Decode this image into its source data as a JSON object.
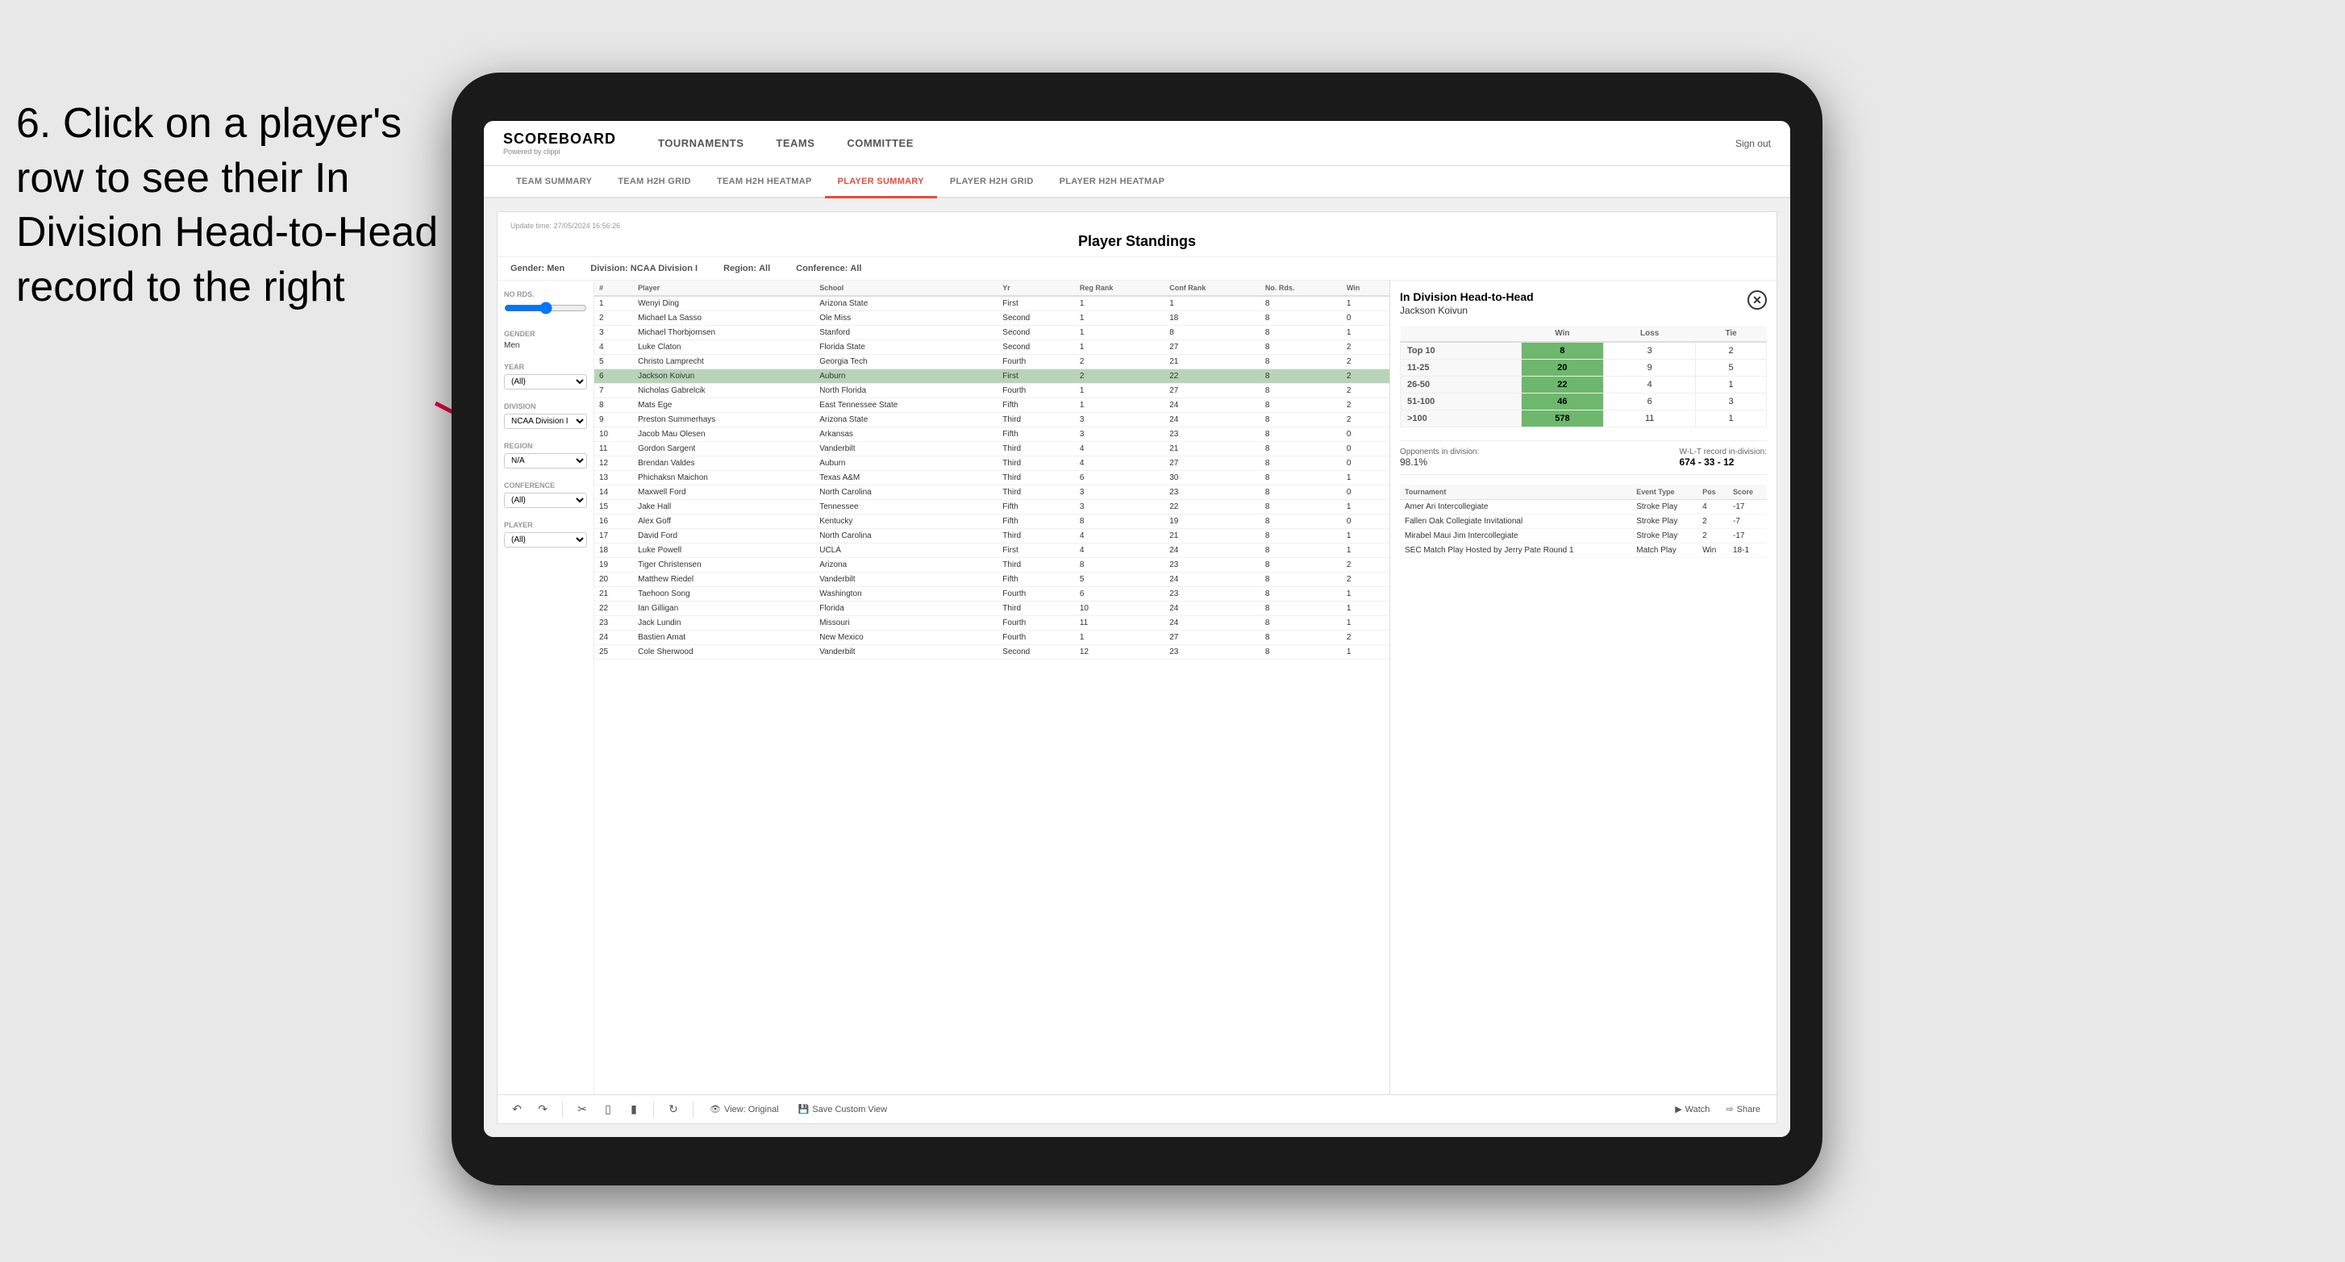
{
  "instruction": {
    "text": "6. Click on a player's row to see their In Division Head-to-Head record to the right"
  },
  "nav": {
    "logo": "SCOREBOARD",
    "logo_sub": "Powered by clippi",
    "items": [
      "TOURNAMENTS",
      "TEAMS",
      "COMMITTEE"
    ],
    "sign_out": "Sign out"
  },
  "sub_nav": {
    "items": [
      "TEAM SUMMARY",
      "TEAM H2H GRID",
      "TEAM H2H HEATMAP",
      "PLAYER SUMMARY",
      "PLAYER H2H GRID",
      "PLAYER H2H HEATMAP"
    ],
    "active": "PLAYER SUMMARY"
  },
  "panel": {
    "update_label": "Update time:",
    "update_time": "27/05/2024 16:56:26",
    "title": "Player Standings",
    "filters": {
      "gender_label": "Gender:",
      "gender_value": "Men",
      "division_label": "Division:",
      "division_value": "NCAA Division I",
      "region_label": "Region:",
      "region_value": "All",
      "conference_label": "Conference:",
      "conference_value": "All"
    }
  },
  "sidebar": {
    "no_rds_label": "No Rds.",
    "gender_label": "Gender",
    "gender_value": "Men",
    "year_label": "Year",
    "year_value": "(All)",
    "division_label": "Division",
    "division_value": "NCAA Division I",
    "region_label": "Region",
    "region_value": "N/A",
    "conference_label": "Conference",
    "conference_value": "(All)",
    "player_label": "Player",
    "player_value": "(All)"
  },
  "table": {
    "headers": [
      "#",
      "Player",
      "School",
      "Yr",
      "Reg Rank",
      "Conf Rank",
      "No. Rds.",
      "Win"
    ],
    "rows": [
      {
        "num": 1,
        "player": "Wenyi Ding",
        "school": "Arizona State",
        "yr": "First",
        "reg_rank": 1,
        "conf_rank": 1,
        "no_rds": 8,
        "win": 1,
        "selected": false
      },
      {
        "num": 2,
        "player": "Michael La Sasso",
        "school": "Ole Miss",
        "yr": "Second",
        "reg_rank": 1,
        "conf_rank": 18,
        "no_rds": 8,
        "win": 0,
        "selected": false
      },
      {
        "num": 3,
        "player": "Michael Thorbjornsen",
        "school": "Stanford",
        "yr": "Second",
        "reg_rank": 1,
        "conf_rank": 8,
        "no_rds": 8,
        "win": 1,
        "selected": false
      },
      {
        "num": 4,
        "player": "Luke Claton",
        "school": "Florida State",
        "yr": "Second",
        "reg_rank": 1,
        "conf_rank": 27,
        "no_rds": 8,
        "win": 2,
        "selected": false
      },
      {
        "num": 5,
        "player": "Christo Lamprecht",
        "school": "Georgia Tech",
        "yr": "Fourth",
        "reg_rank": 2,
        "conf_rank": 21,
        "no_rds": 8,
        "win": 2,
        "selected": false
      },
      {
        "num": 6,
        "player": "Jackson Koivun",
        "school": "Auburn",
        "yr": "First",
        "reg_rank": 2,
        "conf_rank": 22,
        "no_rds": 8,
        "win": 2,
        "selected": true
      },
      {
        "num": 7,
        "player": "Nicholas Gabrelcik",
        "school": "North Florida",
        "yr": "Fourth",
        "reg_rank": 1,
        "conf_rank": 27,
        "no_rds": 8,
        "win": 2,
        "selected": false
      },
      {
        "num": 8,
        "player": "Mats Ege",
        "school": "East Tennessee State",
        "yr": "Fifth",
        "reg_rank": 1,
        "conf_rank": 24,
        "no_rds": 8,
        "win": 2,
        "selected": false
      },
      {
        "num": 9,
        "player": "Preston Summerhays",
        "school": "Arizona State",
        "yr": "Third",
        "reg_rank": 3,
        "conf_rank": 24,
        "no_rds": 8,
        "win": 2,
        "selected": false
      },
      {
        "num": 10,
        "player": "Jacob Mau Olesen",
        "school": "Arkansas",
        "yr": "Fifth",
        "reg_rank": 3,
        "conf_rank": 23,
        "no_rds": 8,
        "win": 0,
        "selected": false
      },
      {
        "num": 11,
        "player": "Gordon Sargent",
        "school": "Vanderbilt",
        "yr": "Third",
        "reg_rank": 4,
        "conf_rank": 21,
        "no_rds": 8,
        "win": 0,
        "selected": false
      },
      {
        "num": 12,
        "player": "Brendan Valdes",
        "school": "Auburn",
        "yr": "Third",
        "reg_rank": 4,
        "conf_rank": 27,
        "no_rds": 8,
        "win": 0,
        "selected": false
      },
      {
        "num": 13,
        "player": "Phichaksn Maichon",
        "school": "Texas A&M",
        "yr": "Third",
        "reg_rank": 6,
        "conf_rank": 30,
        "no_rds": 8,
        "win": 1,
        "selected": false
      },
      {
        "num": 14,
        "player": "Maxwell Ford",
        "school": "North Carolina",
        "yr": "Third",
        "reg_rank": 3,
        "conf_rank": 23,
        "no_rds": 8,
        "win": 0,
        "selected": false
      },
      {
        "num": 15,
        "player": "Jake Hall",
        "school": "Tennessee",
        "yr": "Fifth",
        "reg_rank": 3,
        "conf_rank": 22,
        "no_rds": 8,
        "win": 1,
        "selected": false
      },
      {
        "num": 16,
        "player": "Alex Goff",
        "school": "Kentucky",
        "yr": "Fifth",
        "reg_rank": 8,
        "conf_rank": 19,
        "no_rds": 8,
        "win": 0,
        "selected": false
      },
      {
        "num": 17,
        "player": "David Ford",
        "school": "North Carolina",
        "yr": "Third",
        "reg_rank": 4,
        "conf_rank": 21,
        "no_rds": 8,
        "win": 1,
        "selected": false
      },
      {
        "num": 18,
        "player": "Luke Powell",
        "school": "UCLA",
        "yr": "First",
        "reg_rank": 4,
        "conf_rank": 24,
        "no_rds": 8,
        "win": 1,
        "selected": false
      },
      {
        "num": 19,
        "player": "Tiger Christensen",
        "school": "Arizona",
        "yr": "Third",
        "reg_rank": 8,
        "conf_rank": 23,
        "no_rds": 8,
        "win": 2,
        "selected": false
      },
      {
        "num": 20,
        "player": "Matthew Riedel",
        "school": "Vanderbilt",
        "yr": "Fifth",
        "reg_rank": 5,
        "conf_rank": 24,
        "no_rds": 8,
        "win": 2,
        "selected": false
      },
      {
        "num": 21,
        "player": "Taehoon Song",
        "school": "Washington",
        "yr": "Fourth",
        "reg_rank": 6,
        "conf_rank": 23,
        "no_rds": 8,
        "win": 1,
        "selected": false
      },
      {
        "num": 22,
        "player": "Ian Gilligan",
        "school": "Florida",
        "yr": "Third",
        "reg_rank": 10,
        "conf_rank": 24,
        "no_rds": 8,
        "win": 1,
        "selected": false
      },
      {
        "num": 23,
        "player": "Jack Lundin",
        "school": "Missouri",
        "yr": "Fourth",
        "reg_rank": 11,
        "conf_rank": 24,
        "no_rds": 8,
        "win": 1,
        "selected": false
      },
      {
        "num": 24,
        "player": "Bastien Amat",
        "school": "New Mexico",
        "yr": "Fourth",
        "reg_rank": 1,
        "conf_rank": 27,
        "no_rds": 8,
        "win": 2,
        "selected": false
      },
      {
        "num": 25,
        "player": "Cole Sherwood",
        "school": "Vanderbilt",
        "yr": "Second",
        "reg_rank": 12,
        "conf_rank": 23,
        "no_rds": 8,
        "win": 1,
        "selected": false
      }
    ]
  },
  "h2h": {
    "title": "In Division Head-to-Head",
    "player": "Jackson Koivun",
    "table_headers": [
      "",
      "Win",
      "Loss",
      "Tie"
    ],
    "rows": [
      {
        "label": "Top 10",
        "win": 8,
        "loss": 3,
        "tie": 2
      },
      {
        "label": "11-25",
        "win": 20,
        "loss": 9,
        "tie": 5
      },
      {
        "label": "26-50",
        "win": 22,
        "loss": 4,
        "tie": 1
      },
      {
        "label": "51-100",
        "win": 46,
        "loss": 6,
        "tie": 3
      },
      {
        "label": ">100",
        "win": 578,
        "loss": 11,
        "tie": 1
      }
    ],
    "opponents_label": "Opponents in division:",
    "opponents_pct": "98.1%",
    "record_label": "W-L-T record in-division:",
    "record": "674 - 33 - 12",
    "tournaments_headers": [
      "Tournament",
      "Event Type",
      "Pos",
      "Score"
    ],
    "tournaments": [
      {
        "name": "Amer Ari Intercollegiate",
        "type": "Stroke Play",
        "pos": 4,
        "score": "-17"
      },
      {
        "name": "Fallen Oak Collegiate Invitational",
        "type": "Stroke Play",
        "pos": 2,
        "score": "-7"
      },
      {
        "name": "Mirabel Maui Jim Intercollegiate",
        "type": "Stroke Play",
        "pos": 2,
        "score": "-17"
      },
      {
        "name": "SEC Match Play Hosted by Jerry Pate Round 1",
        "type": "Match Play",
        "pos": "Win",
        "score": "18-1"
      }
    ]
  },
  "toolbar": {
    "view_original": "View: Original",
    "save_custom": "Save Custom View",
    "watch": "Watch",
    "share": "Share"
  }
}
